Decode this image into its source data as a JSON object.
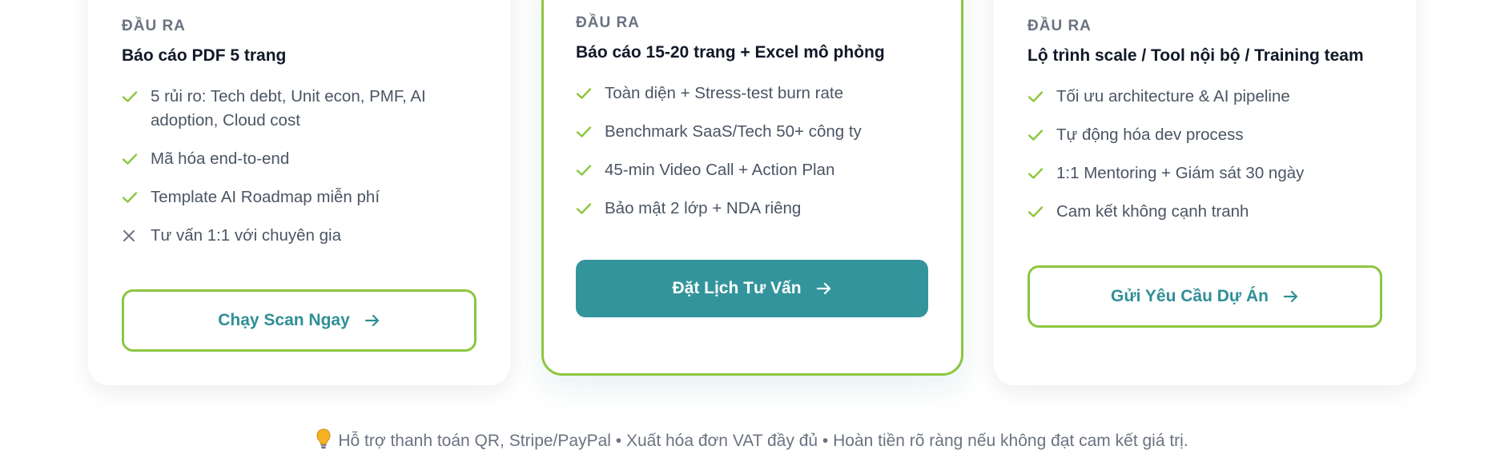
{
  "cards": [
    {
      "label": "ĐẦU RA",
      "subtitle": "Báo cáo PDF 5 trang",
      "features": [
        {
          "text": "5 rủi ro: Tech debt, Unit econ, PMF, AI adoption, Cloud cost",
          "icon": "check-icon",
          "included": true
        },
        {
          "text": "Mã hóa end-to-end",
          "icon": "check-icon",
          "included": true
        },
        {
          "text": "Template AI Roadmap miễn phí",
          "icon": "check-icon",
          "included": true
        },
        {
          "text": "Tư vấn 1:1 với chuyên gia",
          "icon": "x-icon",
          "included": false
        }
      ],
      "button_label": "Chạy Scan Ngay",
      "button_style": "outline"
    },
    {
      "label": "ĐẦU RA",
      "subtitle": "Báo cáo 15-20 trang + Excel mô phỏng",
      "features": [
        {
          "text": "Toàn diện + Stress-test burn rate",
          "icon": "check-icon",
          "included": true
        },
        {
          "text": "Benchmark SaaS/Tech 50+ công ty",
          "icon": "check-icon",
          "included": true
        },
        {
          "text": "45-min Video Call + Action Plan",
          "icon": "check-icon",
          "included": true
        },
        {
          "text": "Bảo mật 2 lớp + NDA riêng",
          "icon": "check-icon",
          "included": true
        }
      ],
      "button_label": "Đặt Lịch Tư Vấn",
      "button_style": "solid"
    },
    {
      "label": "ĐẦU RA",
      "subtitle": "Lộ trình scale / Tool nội bộ / Training team",
      "features": [
        {
          "text": "Tối ưu architecture & AI pipeline",
          "icon": "check-icon",
          "included": true
        },
        {
          "text": "Tự động hóa dev process",
          "icon": "check-icon",
          "included": true
        },
        {
          "text": "1:1 Mentoring + Giám sát 30 ngày",
          "icon": "check-icon",
          "included": true
        },
        {
          "text": "Cam kết không cạnh tranh",
          "icon": "check-icon",
          "included": true
        }
      ],
      "button_label": "Gửi Yêu Cầu Dự Án",
      "button_style": "outline"
    }
  ],
  "footer": {
    "icon": "lightbulb-icon",
    "text": "Hỗ trợ thanh toán QR, Stripe/PayPal • Xuất hóa đơn VAT đầy đủ • Hoàn tiền rõ ràng nếu không đạt cam kết giá trị."
  },
  "colors": {
    "accent_green": "#8cc63f",
    "teal": "#33959b",
    "teal_text": "#2f8f95",
    "muted": "#6b7280"
  }
}
